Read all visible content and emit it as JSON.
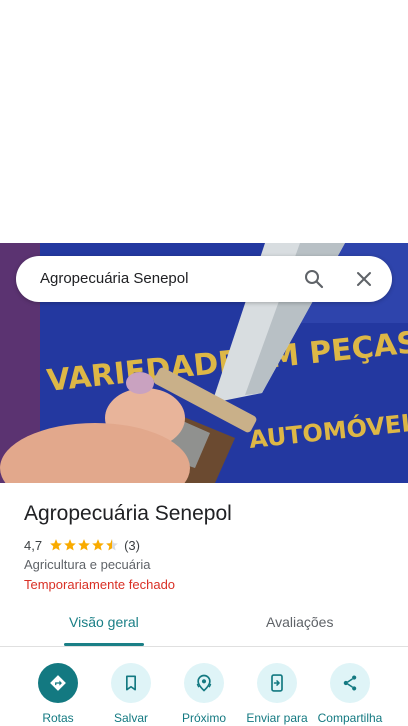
{
  "search": {
    "query": "Agropecuária Senepol"
  },
  "photo": {
    "description_icon": "knife-photo",
    "banner_text_line1": "VARIEDADE EM PEÇAS",
    "banner_text_line2": "AUTOMÓVEL"
  },
  "place": {
    "name": "Agropecuária Senepol",
    "rating": "4,7",
    "rating_value": 4.7,
    "review_count": "(3)",
    "category": "Agricultura e pecuária",
    "status": "Temporariamente fechado"
  },
  "tabs": [
    {
      "label": "Visão geral",
      "active": true
    },
    {
      "label": "Avaliações",
      "active": false
    }
  ],
  "actions": [
    {
      "label": "Rotas",
      "icon": "directions-icon"
    },
    {
      "label": "Salvar",
      "icon": "bookmark-icon"
    },
    {
      "label": "Próximo",
      "icon": "nearby-icon"
    },
    {
      "label": "Enviar para",
      "icon": "send-to-phone-icon"
    },
    {
      "label": "Compartilha",
      "icon": "share-icon"
    }
  ],
  "colors": {
    "accent": "#137981",
    "status_closed": "#d93025",
    "star": "#f9ab00"
  }
}
